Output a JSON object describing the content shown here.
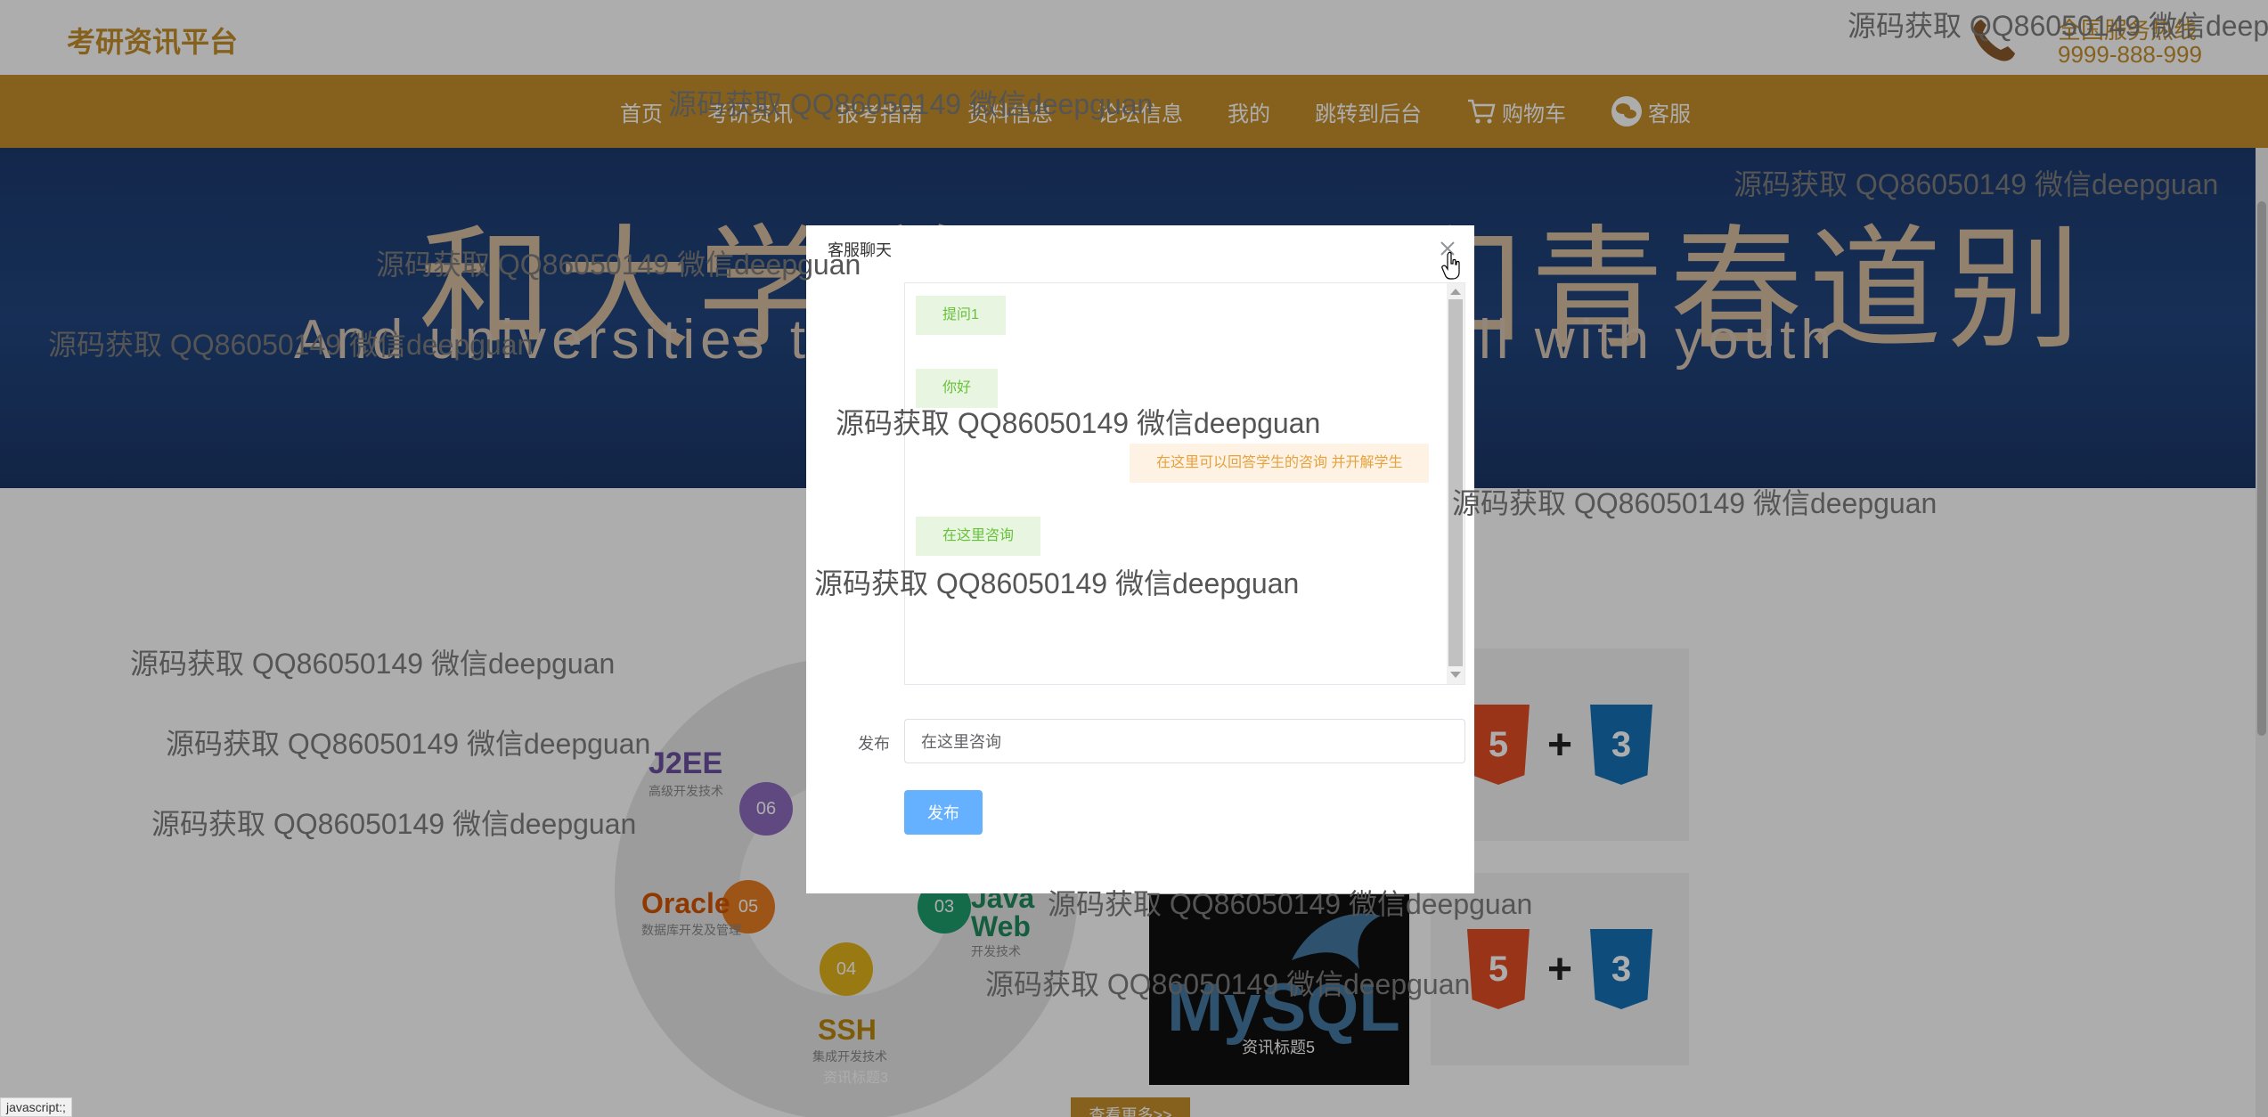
{
  "header": {
    "logo": "考研资讯平台",
    "hotline_label": "全国服务热线",
    "hotline_number": "9999-888-999"
  },
  "nav": {
    "items": [
      {
        "label": "首页",
        "icon": ""
      },
      {
        "label": "考研资讯",
        "icon": ""
      },
      {
        "label": "报考指南",
        "icon": ""
      },
      {
        "label": "资料信息",
        "icon": ""
      },
      {
        "label": "论坛信息",
        "icon": ""
      },
      {
        "label": "我的",
        "icon": ""
      },
      {
        "label": "跳转到后台",
        "icon": ""
      },
      {
        "label": "购物车",
        "icon": "cart-icon"
      },
      {
        "label": "客服",
        "icon": "wechat-icon"
      }
    ]
  },
  "banner": {
    "title": "和大学说再见　和青春道别",
    "subtitle": "And universities to say goodbye, farewell with youth"
  },
  "content": {
    "wheel": {
      "segments": [
        {
          "num": "06",
          "title": "J2EE",
          "sub": "高级开发技术"
        },
        {
          "num": "05",
          "title": "Oracle",
          "sub": "数据库开发及管理"
        },
        {
          "num": "04",
          "title": "SSH",
          "sub": "集成开发技术"
        },
        {
          "num": "03",
          "title": "Java Web",
          "sub": "开发技术"
        }
      ],
      "caption": "资讯标题3"
    },
    "mysql_caption": "资讯标题5",
    "mysql_word": "MySQL",
    "html_label": "5",
    "css_label": "3",
    "more_button": "查看更多>>"
  },
  "dialog": {
    "title": "客服聊天",
    "messages": [
      {
        "role": "user",
        "text": "提问1"
      },
      {
        "role": "user",
        "text": "你好"
      },
      {
        "role": "service",
        "text": "在这里可以回答学生的咨询 并开解学生"
      },
      {
        "role": "user",
        "text": "在这里咨询"
      }
    ],
    "form_label": "发布",
    "input_value": "在这里咨询",
    "submit_label": "发布"
  },
  "watermark": {
    "text": "源码获取 QQ86050149 微信deepguan"
  },
  "status_bar": "javascript:;",
  "colors": {
    "brand": "#c4902b",
    "primary_button": "#66b1ff",
    "user_bubble_bg": "#e8f5e0",
    "user_bubble_text": "#67c23a",
    "service_bubble_bg": "#fdf2e3",
    "service_bubble_text": "#e6a23c"
  }
}
